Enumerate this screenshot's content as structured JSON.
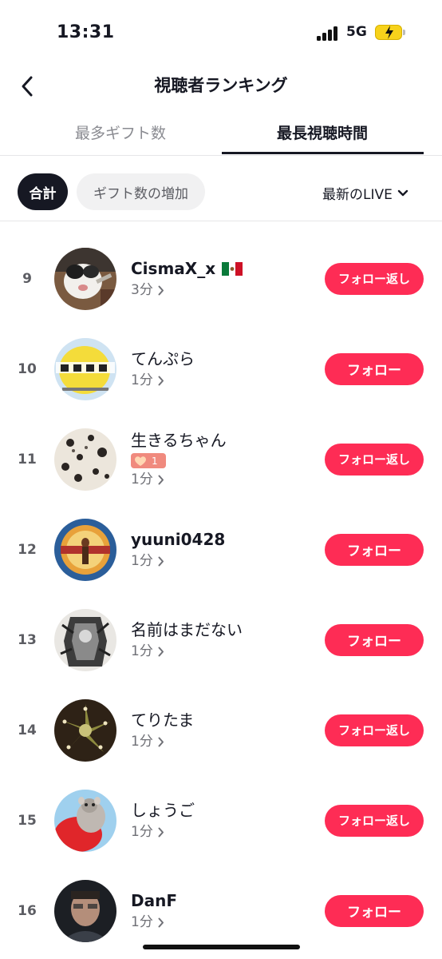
{
  "status_bar": {
    "time": "13:31",
    "network": "5G"
  },
  "header": {
    "title": "視聴者ランキング"
  },
  "tabs": [
    {
      "label": "最多ギフト数",
      "active": false
    },
    {
      "label": "最長視聴時間",
      "active": true
    }
  ],
  "filters": {
    "chips": [
      {
        "label": "合計",
        "active": true
      },
      {
        "label": "ギフト数の増加",
        "active": false
      }
    ],
    "live_select": "最新のLIVE"
  },
  "colors": {
    "accent": "#fe2c55",
    "text": "#161823",
    "secondary_text": "#6f7076"
  },
  "viewers": [
    {
      "rank": "9",
      "name": "CismaX_x",
      "flag": "mexico-flag",
      "duration": "3分",
      "button": "フォロー返し"
    },
    {
      "rank": "10",
      "name": "てんぷら",
      "duration": "1分",
      "button": "フォロー"
    },
    {
      "rank": "11",
      "name": "生きるちゃん",
      "badge": "1",
      "duration": "1分",
      "button": "フォロー返し"
    },
    {
      "rank": "12",
      "name": "yuuni0428",
      "duration": "1分",
      "button": "フォロー"
    },
    {
      "rank": "13",
      "name": "名前はまだない",
      "duration": "1分",
      "button": "フォロー"
    },
    {
      "rank": "14",
      "name": "てりたま",
      "duration": "1分",
      "button": "フォロー返し"
    },
    {
      "rank": "15",
      "name": "しょうご",
      "duration": "1分",
      "button": "フォロー返し"
    },
    {
      "rank": "16",
      "name": "DanF",
      "duration": "1分",
      "button": "フォロー"
    }
  ]
}
